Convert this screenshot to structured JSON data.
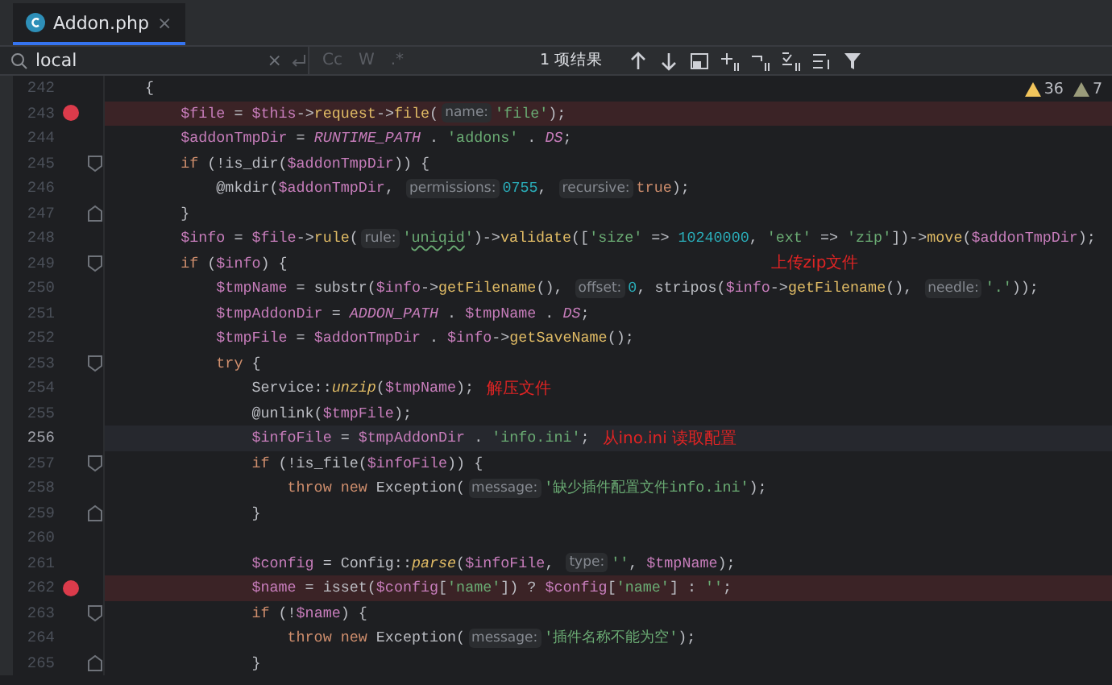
{
  "tab": {
    "label": "Addon.php",
    "close": "×",
    "selected": true
  },
  "search": {
    "value": "local",
    "clear": "×",
    "options": [
      {
        "label": "Cc",
        "selected": false
      },
      {
        "label": "W",
        "selected": false
      },
      {
        "label": ".*",
        "selected": false
      }
    ],
    "result": "1 项结果"
  },
  "inspections": [
    {
      "kind": "warning",
      "count": "36"
    },
    {
      "kind": "weak",
      "count": "7"
    }
  ],
  "lines": [
    {
      "number": "242",
      "breakpoint": false,
      "current": false,
      "fold_open": false,
      "fold_close": false,
      "tokens": [
        {
          "kind": "plain",
          "text": "    {"
        }
      ]
    },
    {
      "number": "243",
      "breakpoint": true,
      "current": false,
      "fold_open": false,
      "fold_close": false,
      "tokens": [
        {
          "kind": "var",
          "text": "        $file"
        },
        {
          "kind": "plain",
          "text": " = "
        },
        {
          "kind": "var",
          "text": "$this"
        },
        {
          "kind": "plain",
          "text": "->"
        },
        {
          "kind": "method",
          "text": "request"
        },
        {
          "kind": "plain",
          "text": "->"
        },
        {
          "kind": "method",
          "text": "file"
        },
        {
          "kind": "plain",
          "text": "("
        },
        {
          "kind": "hint",
          "text": "name:"
        },
        {
          "kind": "string",
          "text": "'file'"
        },
        {
          "kind": "plain",
          "text": ");"
        }
      ]
    },
    {
      "number": "244",
      "breakpoint": false,
      "current": false,
      "fold_open": false,
      "fold_close": false,
      "tokens": [
        {
          "kind": "var",
          "text": "        $addonTmpDir"
        },
        {
          "kind": "plain",
          "text": " = "
        },
        {
          "kind": "const",
          "text": "RUNTIME_PATH"
        },
        {
          "kind": "plain",
          "text": " . "
        },
        {
          "kind": "string",
          "text": "'addons'"
        },
        {
          "kind": "plain",
          "text": " . "
        },
        {
          "kind": "const",
          "text": "DS"
        },
        {
          "kind": "plain",
          "text": ";"
        }
      ]
    },
    {
      "number": "245",
      "breakpoint": false,
      "current": false,
      "fold_open": true,
      "fold_close": false,
      "tokens": [
        {
          "kind": "keyword",
          "text": "        if"
        },
        {
          "kind": "plain",
          "text": " (!is_dir("
        },
        {
          "kind": "var",
          "text": "$addonTmpDir"
        },
        {
          "kind": "plain",
          "text": ")) {"
        }
      ]
    },
    {
      "number": "246",
      "breakpoint": false,
      "current": false,
      "fold_open": false,
      "fold_close": false,
      "tokens": [
        {
          "kind": "plain",
          "text": "            @mkdir("
        },
        {
          "kind": "var",
          "text": "$addonTmpDir"
        },
        {
          "kind": "plain",
          "text": ", "
        },
        {
          "kind": "hint",
          "text": "permissions:"
        },
        {
          "kind": "number",
          "text": "0755"
        },
        {
          "kind": "plain",
          "text": ", "
        },
        {
          "kind": "hint",
          "text": "recursive:"
        },
        {
          "kind": "keyword",
          "text": "true"
        },
        {
          "kind": "plain",
          "text": ");"
        }
      ]
    },
    {
      "number": "247",
      "breakpoint": false,
      "current": false,
      "fold_open": false,
      "fold_close": true,
      "tokens": [
        {
          "kind": "plain",
          "text": "        }"
        }
      ]
    },
    {
      "number": "248",
      "breakpoint": false,
      "current": false,
      "fold_open": false,
      "fold_close": false,
      "tokens": [
        {
          "kind": "var",
          "text": "        $info"
        },
        {
          "kind": "plain",
          "text": " = "
        },
        {
          "kind": "var",
          "text": "$file"
        },
        {
          "kind": "plain",
          "text": "->"
        },
        {
          "kind": "method",
          "text": "rule"
        },
        {
          "kind": "plain",
          "text": "("
        },
        {
          "kind": "hint",
          "text": "rule:"
        },
        {
          "kind": "string",
          "text": "'"
        },
        {
          "kind": "typo",
          "text": "uniqid"
        },
        {
          "kind": "string",
          "text": "'"
        },
        {
          "kind": "plain",
          "text": ")->"
        },
        {
          "kind": "method",
          "text": "validate"
        },
        {
          "kind": "plain",
          "text": "(["
        },
        {
          "kind": "string",
          "text": "'size'"
        },
        {
          "kind": "plain",
          "text": " => "
        },
        {
          "kind": "number",
          "text": "10240000"
        },
        {
          "kind": "plain",
          "text": ", "
        },
        {
          "kind": "string",
          "text": "'ext'"
        },
        {
          "kind": "plain",
          "text": " => "
        },
        {
          "kind": "string",
          "text": "'zip'"
        },
        {
          "kind": "plain",
          "text": "])->"
        },
        {
          "kind": "method",
          "text": "move"
        },
        {
          "kind": "plain",
          "text": "("
        },
        {
          "kind": "var",
          "text": "$addonTmpDir"
        },
        {
          "kind": "plain",
          "text": ");"
        }
      ]
    },
    {
      "number": "249",
      "breakpoint": false,
      "current": false,
      "fold_open": true,
      "fold_close": false,
      "note": {
        "text": "上传zip文件",
        "detached": true
      },
      "tokens": [
        {
          "kind": "keyword",
          "text": "        if"
        },
        {
          "kind": "plain",
          "text": " ("
        },
        {
          "kind": "var",
          "text": "$info"
        },
        {
          "kind": "plain",
          "text": ") {"
        }
      ]
    },
    {
      "number": "250",
      "breakpoint": false,
      "current": false,
      "fold_open": false,
      "fold_close": false,
      "tokens": [
        {
          "kind": "var",
          "text": "            $tmpName"
        },
        {
          "kind": "plain",
          "text": " = substr("
        },
        {
          "kind": "var",
          "text": "$info"
        },
        {
          "kind": "plain",
          "text": "->"
        },
        {
          "kind": "method",
          "text": "getFilename"
        },
        {
          "kind": "plain",
          "text": "(), "
        },
        {
          "kind": "hint",
          "text": "offset:"
        },
        {
          "kind": "number",
          "text": "0"
        },
        {
          "kind": "plain",
          "text": ", stripos("
        },
        {
          "kind": "var",
          "text": "$info"
        },
        {
          "kind": "plain",
          "text": "->"
        },
        {
          "kind": "method",
          "text": "getFilename"
        },
        {
          "kind": "plain",
          "text": "(), "
        },
        {
          "kind": "hint",
          "text": "needle:"
        },
        {
          "kind": "string",
          "text": "'.'"
        },
        {
          "kind": "plain",
          "text": "));"
        }
      ]
    },
    {
      "number": "251",
      "breakpoint": false,
      "current": false,
      "fold_open": false,
      "fold_close": false,
      "tokens": [
        {
          "kind": "var",
          "text": "            $tmpAddonDir"
        },
        {
          "kind": "plain",
          "text": " = "
        },
        {
          "kind": "const",
          "text": "ADDON_PATH"
        },
        {
          "kind": "plain",
          "text": " . "
        },
        {
          "kind": "var",
          "text": "$tmpName"
        },
        {
          "kind": "plain",
          "text": " . "
        },
        {
          "kind": "const",
          "text": "DS"
        },
        {
          "kind": "plain",
          "text": ";"
        }
      ]
    },
    {
      "number": "252",
      "breakpoint": false,
      "current": false,
      "fold_open": false,
      "fold_close": false,
      "tokens": [
        {
          "kind": "var",
          "text": "            $tmpFile"
        },
        {
          "kind": "plain",
          "text": " = "
        },
        {
          "kind": "var",
          "text": "$addonTmpDir"
        },
        {
          "kind": "plain",
          "text": " . "
        },
        {
          "kind": "var",
          "text": "$info"
        },
        {
          "kind": "plain",
          "text": "->"
        },
        {
          "kind": "method",
          "text": "getSaveName"
        },
        {
          "kind": "plain",
          "text": "();"
        }
      ]
    },
    {
      "number": "253",
      "breakpoint": false,
      "current": false,
      "fold_open": true,
      "fold_close": false,
      "tokens": [
        {
          "kind": "keyword",
          "text": "            try"
        },
        {
          "kind": "plain",
          "text": " {"
        }
      ]
    },
    {
      "number": "254",
      "breakpoint": false,
      "current": false,
      "fold_open": false,
      "fold_close": false,
      "note": {
        "text": "解压文件",
        "detached": false
      },
      "tokens": [
        {
          "kind": "plain",
          "text": "                Service::"
        },
        {
          "kind": "static",
          "text": "unzip"
        },
        {
          "kind": "plain",
          "text": "("
        },
        {
          "kind": "var",
          "text": "$tmpName"
        },
        {
          "kind": "plain",
          "text": ");"
        }
      ]
    },
    {
      "number": "255",
      "breakpoint": false,
      "current": false,
      "fold_open": false,
      "fold_close": false,
      "tokens": [
        {
          "kind": "plain",
          "text": "                @unlink("
        },
        {
          "kind": "var",
          "text": "$tmpFile"
        },
        {
          "kind": "plain",
          "text": ");"
        }
      ]
    },
    {
      "number": "256",
      "breakpoint": false,
      "current": true,
      "fold_open": false,
      "fold_close": false,
      "note": {
        "text": "从ino.ini 读取配置",
        "detached": false
      },
      "tokens": [
        {
          "kind": "var",
          "text": "                $infoFile"
        },
        {
          "kind": "plain",
          "text": " = "
        },
        {
          "kind": "var",
          "text": "$tmpAddonDir"
        },
        {
          "kind": "plain",
          "text": " . "
        },
        {
          "kind": "string",
          "text": "'info.ini'"
        },
        {
          "kind": "plain",
          "text": ";"
        }
      ]
    },
    {
      "number": "257",
      "breakpoint": false,
      "current": false,
      "fold_open": true,
      "fold_close": false,
      "tokens": [
        {
          "kind": "keyword",
          "text": "                if"
        },
        {
          "kind": "plain",
          "text": " (!is_file("
        },
        {
          "kind": "var",
          "text": "$infoFile"
        },
        {
          "kind": "plain",
          "text": ")) {"
        }
      ]
    },
    {
      "number": "258",
      "breakpoint": false,
      "current": false,
      "fold_open": false,
      "fold_close": false,
      "tokens": [
        {
          "kind": "keyword",
          "text": "                    throw new"
        },
        {
          "kind": "plain",
          "text": " Exception("
        },
        {
          "kind": "hint",
          "text": "message:"
        },
        {
          "kind": "string",
          "text": "'缺少插件配置文件info.ini'"
        },
        {
          "kind": "plain",
          "text": ");"
        }
      ]
    },
    {
      "number": "259",
      "breakpoint": false,
      "current": false,
      "fold_open": false,
      "fold_close": true,
      "tokens": [
        {
          "kind": "plain",
          "text": "                }"
        }
      ]
    },
    {
      "number": "260",
      "breakpoint": false,
      "current": false,
      "fold_open": false,
      "fold_close": false
    },
    {
      "number": "261",
      "breakpoint": false,
      "current": false,
      "fold_open": false,
      "fold_close": false,
      "tokens": [
        {
          "kind": "var",
          "text": "                $config"
        },
        {
          "kind": "plain",
          "text": " = Config::"
        },
        {
          "kind": "static",
          "text": "parse"
        },
        {
          "kind": "plain",
          "text": "("
        },
        {
          "kind": "var",
          "text": "$infoFile"
        },
        {
          "kind": "plain",
          "text": ", "
        },
        {
          "kind": "hint",
          "text": "type:"
        },
        {
          "kind": "string",
          "text": "''"
        },
        {
          "kind": "plain",
          "text": ", "
        },
        {
          "kind": "var",
          "text": "$tmpName"
        },
        {
          "kind": "plain",
          "text": ");"
        }
      ]
    },
    {
      "number": "262",
      "breakpoint": true,
      "current": false,
      "fold_open": false,
      "fold_close": false,
      "tokens": [
        {
          "kind": "var",
          "text": "                $name"
        },
        {
          "kind": "plain",
          "text": " = isset("
        },
        {
          "kind": "var",
          "text": "$config"
        },
        {
          "kind": "plain",
          "text": "["
        },
        {
          "kind": "string",
          "text": "'name'"
        },
        {
          "kind": "plain",
          "text": "]) ? "
        },
        {
          "kind": "var",
          "text": "$config"
        },
        {
          "kind": "plain",
          "text": "["
        },
        {
          "kind": "string",
          "text": "'name'"
        },
        {
          "kind": "plain",
          "text": "] : "
        },
        {
          "kind": "string",
          "text": "''"
        },
        {
          "kind": "plain",
          "text": ";"
        }
      ]
    },
    {
      "number": "263",
      "breakpoint": false,
      "current": false,
      "fold_open": true,
      "fold_close": false,
      "tokens": [
        {
          "kind": "keyword",
          "text": "                if"
        },
        {
          "kind": "plain",
          "text": " (!"
        },
        {
          "kind": "var",
          "text": "$name"
        },
        {
          "kind": "plain",
          "text": ") {"
        }
      ]
    },
    {
      "number": "264",
      "breakpoint": false,
      "current": false,
      "fold_open": false,
      "fold_close": false,
      "tokens": [
        {
          "kind": "keyword",
          "text": "                    throw new"
        },
        {
          "kind": "plain",
          "text": " Exception("
        },
        {
          "kind": "hint",
          "text": "message:"
        },
        {
          "kind": "string",
          "text": "'插件名称不能为空'"
        },
        {
          "kind": "plain",
          "text": ");"
        }
      ]
    },
    {
      "number": "265",
      "breakpoint": false,
      "current": false,
      "fold_open": false,
      "fold_close": true,
      "tokens": [
        {
          "kind": "plain",
          "text": "                }"
        }
      ]
    }
  ]
}
